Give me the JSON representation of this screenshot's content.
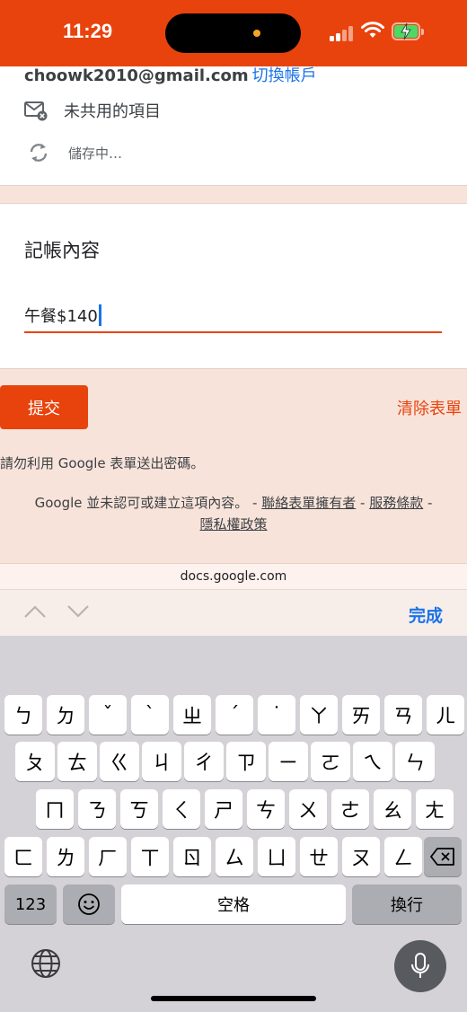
{
  "status_bar": {
    "time": "11:29"
  },
  "account": {
    "email": "choowk2010@gmail.com",
    "switch_label": "切換帳戶",
    "not_shared_label": "未共用的項目",
    "saving_label": "儲存中…"
  },
  "question": {
    "title": "記帳內容",
    "answer_value": "午餐$140"
  },
  "actions": {
    "submit_label": "提交",
    "clear_label": "清除表單"
  },
  "footer": {
    "password_warning": "請勿利用 Google 表單送出密碼。",
    "disclaimer_text": "Google 並未認可或建立這項內容。 - ",
    "contact_owner": "聯絡表單擁有者",
    "sep": " - ",
    "terms": "服務條款",
    "sep2": " -",
    "privacy": "隱私權政策"
  },
  "url_bar": {
    "domain": "docs.google.com"
  },
  "accessory": {
    "done_label": "完成"
  },
  "keyboard": {
    "row1": [
      "ㄅ",
      "ㄉ",
      "ˇ",
      "ˋ",
      "ㄓ",
      "ˊ",
      "˙",
      "ㄚ",
      "ㄞ",
      "ㄢ",
      "ㄦ"
    ],
    "row2": [
      "ㄆ",
      "ㄊ",
      "ㄍ",
      "ㄐ",
      "ㄔ",
      "ㄗ",
      "ㄧ",
      "ㄛ",
      "ㄟ",
      "ㄣ"
    ],
    "row3": [
      "ㄇ",
      "ㄋ",
      "ㄎ",
      "ㄑ",
      "ㄕ",
      "ㄘ",
      "ㄨ",
      "ㄜ",
      "ㄠ",
      "ㄤ"
    ],
    "row4": [
      "ㄈ",
      "ㄌ",
      "ㄏ",
      "ㄒ",
      "ㄖ",
      "ㄙ",
      "ㄩ",
      "ㄝ",
      "ㄡ",
      "ㄥ"
    ],
    "numbers_label": "123",
    "space_label": "空格",
    "return_label": "換行"
  }
}
